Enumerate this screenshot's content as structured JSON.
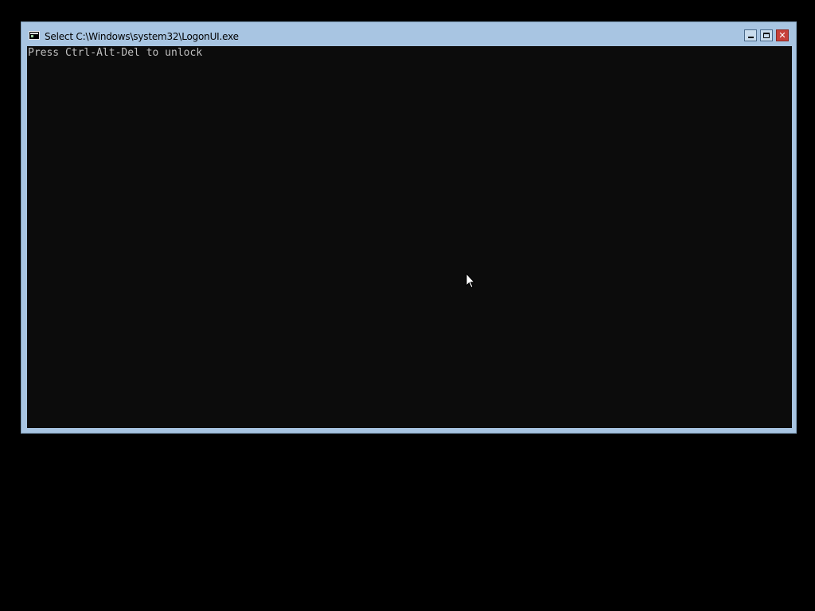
{
  "window": {
    "title": "Select C:\\Windows\\system32\\LogonUI.exe",
    "icon": "console-app-icon",
    "buttons": {
      "minimize": "minimize-icon",
      "maximize": "maximize-icon",
      "close": "close-icon",
      "close_glyph": "✕"
    }
  },
  "console": {
    "lines": [
      "Press Ctrl-Alt-Del to unlock"
    ]
  },
  "colors": {
    "desktop_background": "#000000",
    "window_frame": "#a8c5e2",
    "console_background": "#0c0c0c",
    "console_text": "#c0c0c0",
    "close_button": "#c7403a"
  },
  "cursor": "arrow-cursor-icon"
}
